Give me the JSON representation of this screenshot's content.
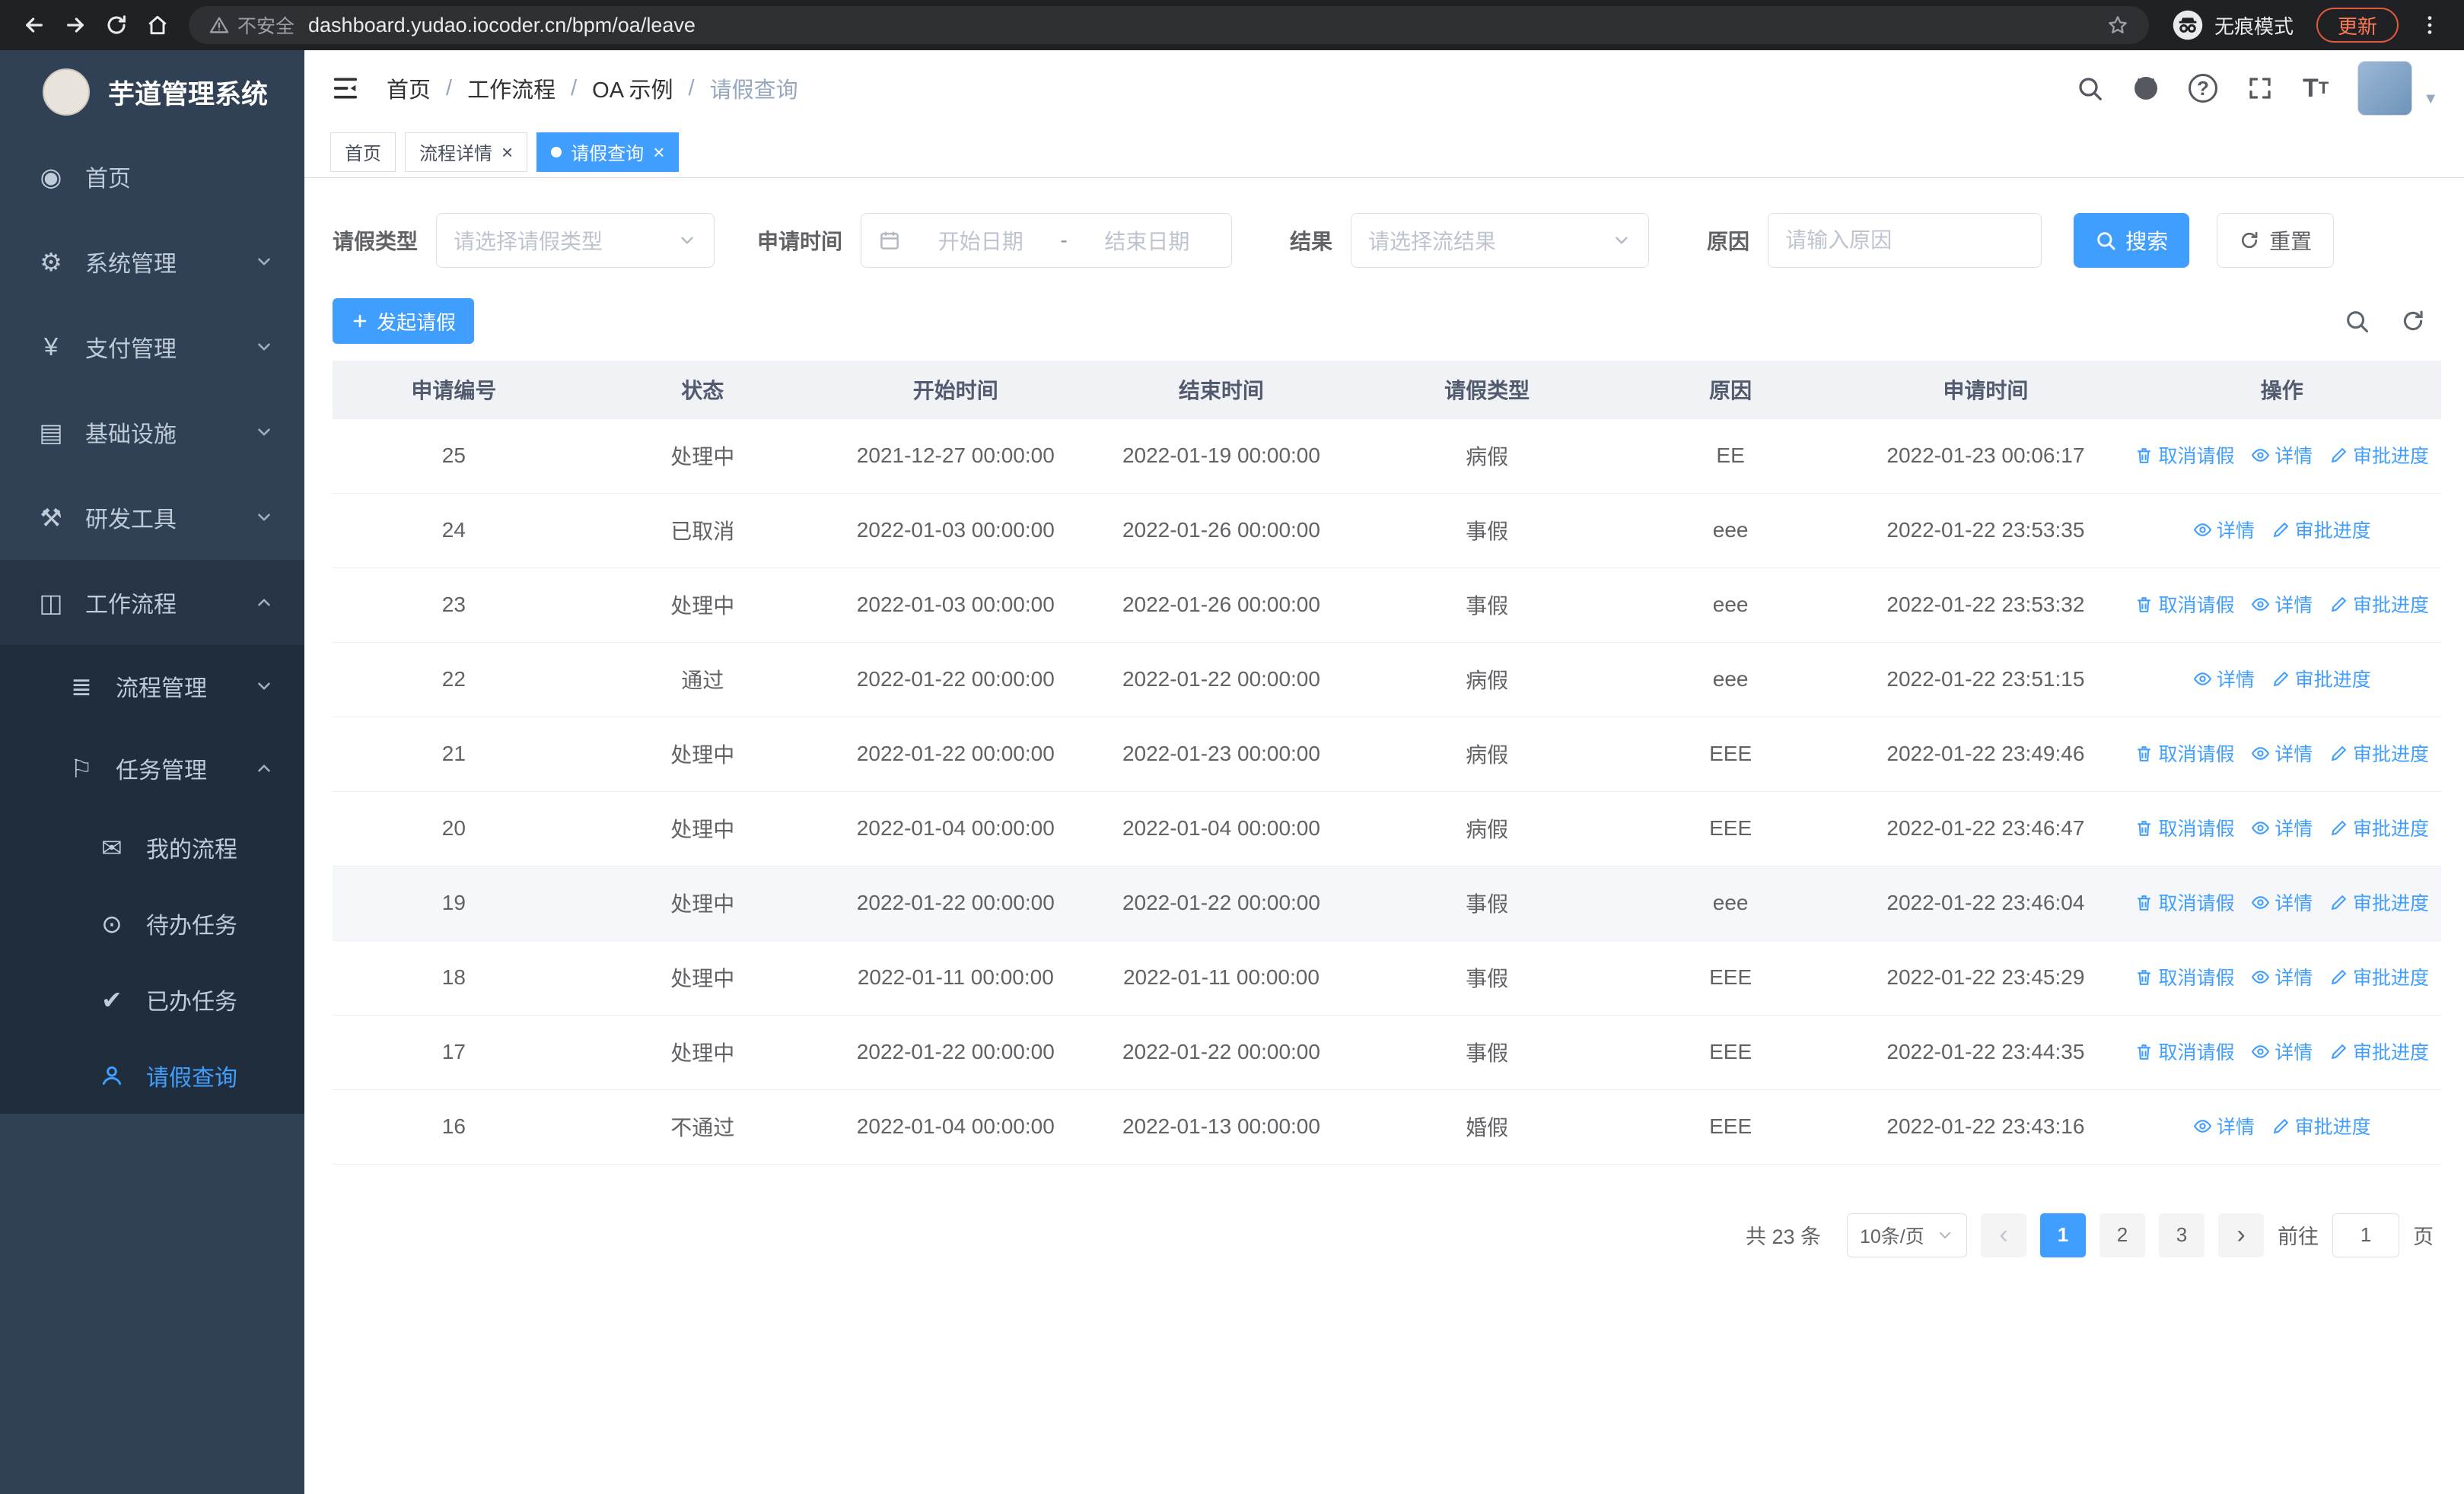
{
  "colors": {
    "accent": "#409eff",
    "sidebar_bg": "#304156",
    "submenu_bg": "#1f2d3d",
    "chrome_bg": "#202124",
    "table_header_bg": "#f0f2f6"
  },
  "browser": {
    "security_label": "不安全",
    "url": "dashboard.yudao.iocoder.cn/bpm/oa/leave",
    "incognito_label": "无痕模式",
    "update_label": "更新"
  },
  "sidebar": {
    "app_title": "芋道管理系统",
    "items": [
      {
        "icon": "dashboard-icon",
        "label": "首页"
      },
      {
        "icon": "gear-icon",
        "label": "系统管理"
      },
      {
        "icon": "yen-icon",
        "label": "支付管理"
      },
      {
        "icon": "infrastructure-icon",
        "label": "基础设施"
      },
      {
        "icon": "tools-icon",
        "label": "研发工具"
      },
      {
        "icon": "workflow-icon",
        "label": "工作流程"
      },
      {
        "icon": "process-list-icon",
        "label": "流程管理"
      },
      {
        "icon": "task-flag-icon",
        "label": "任务管理"
      },
      {
        "icon": "message-icon",
        "label": "我的流程"
      },
      {
        "icon": "eye-icon",
        "label": "待办任务"
      },
      {
        "icon": "check-icon",
        "label": "已办任务"
      },
      {
        "icon": "user-icon",
        "label": "请假查询"
      }
    ]
  },
  "header": {
    "breadcrumb": [
      "首页",
      "工作流程",
      "OA 示例",
      "请假查询"
    ]
  },
  "tabs": [
    {
      "label": "首页"
    },
    {
      "label": "流程详情"
    },
    {
      "label": "请假查询"
    }
  ],
  "filters": {
    "leave_type_label": "请假类型",
    "leave_type_placeholder": "请选择请假类型",
    "apply_time_label": "申请时间",
    "start_date_placeholder": "开始日期",
    "range_separator": "-",
    "end_date_placeholder": "结束日期",
    "result_label": "结果",
    "result_placeholder": "请选择流结果",
    "reason_label": "原因",
    "reason_placeholder": "请输入原因",
    "search_label": "搜索",
    "reset_label": "重置"
  },
  "toolbar": {
    "create_label": "发起请假"
  },
  "table": {
    "headers": [
      "申请编号",
      "状态",
      "开始时间",
      "结束时间",
      "请假类型",
      "原因",
      "申请时间",
      "操作"
    ],
    "actions": {
      "cancel": "取消请假",
      "detail": "详情",
      "progress": "审批进度"
    },
    "rows": [
      {
        "id": "25",
        "status": "处理中",
        "start": "2021-12-27 00:00:00",
        "end": "2022-01-19 00:00:00",
        "type": "病假",
        "reason": "EE",
        "applied": "2022-01-23 00:06:17",
        "ops": [
          "cancel",
          "detail",
          "progress"
        ]
      },
      {
        "id": "24",
        "status": "已取消",
        "start": "2022-01-03 00:00:00",
        "end": "2022-01-26 00:00:00",
        "type": "事假",
        "reason": "eee",
        "applied": "2022-01-22 23:53:35",
        "ops": [
          "detail",
          "progress"
        ]
      },
      {
        "id": "23",
        "status": "处理中",
        "start": "2022-01-03 00:00:00",
        "end": "2022-01-26 00:00:00",
        "type": "事假",
        "reason": "eee",
        "applied": "2022-01-22 23:53:32",
        "ops": [
          "cancel",
          "detail",
          "progress"
        ]
      },
      {
        "id": "22",
        "status": "通过",
        "start": "2022-01-22 00:00:00",
        "end": "2022-01-22 00:00:00",
        "type": "病假",
        "reason": "eee",
        "applied": "2022-01-22 23:51:15",
        "ops": [
          "detail",
          "progress"
        ]
      },
      {
        "id": "21",
        "status": "处理中",
        "start": "2022-01-22 00:00:00",
        "end": "2022-01-23 00:00:00",
        "type": "病假",
        "reason": "EEE",
        "applied": "2022-01-22 23:49:46",
        "ops": [
          "cancel",
          "detail",
          "progress"
        ]
      },
      {
        "id": "20",
        "status": "处理中",
        "start": "2022-01-04 00:00:00",
        "end": "2022-01-04 00:00:00",
        "type": "病假",
        "reason": "EEE",
        "applied": "2022-01-22 23:46:47",
        "ops": [
          "cancel",
          "detail",
          "progress"
        ]
      },
      {
        "id": "19",
        "status": "处理中",
        "start": "2022-01-22 00:00:00",
        "end": "2022-01-22 00:00:00",
        "type": "事假",
        "reason": "eee",
        "applied": "2022-01-22 23:46:04",
        "ops": [
          "cancel",
          "detail",
          "progress"
        ]
      },
      {
        "id": "18",
        "status": "处理中",
        "start": "2022-01-11 00:00:00",
        "end": "2022-01-11 00:00:00",
        "type": "事假",
        "reason": "EEE",
        "applied": "2022-01-22 23:45:29",
        "ops": [
          "cancel",
          "detail",
          "progress"
        ]
      },
      {
        "id": "17",
        "status": "处理中",
        "start": "2022-01-22 00:00:00",
        "end": "2022-01-22 00:00:00",
        "type": "事假",
        "reason": "EEE",
        "applied": "2022-01-22 23:44:35",
        "ops": [
          "cancel",
          "detail",
          "progress"
        ]
      },
      {
        "id": "16",
        "status": "不通过",
        "start": "2022-01-04 00:00:00",
        "end": "2022-01-13 00:00:00",
        "type": "婚假",
        "reason": "EEE",
        "applied": "2022-01-22 23:43:16",
        "ops": [
          "detail",
          "progress"
        ]
      }
    ]
  },
  "pagination": {
    "total_label": "共 23 条",
    "page_size": "10条/页",
    "pages": [
      "1",
      "2",
      "3"
    ],
    "active_page": "1",
    "goto_label": "前往",
    "goto_value": "1",
    "page_unit": "页"
  }
}
